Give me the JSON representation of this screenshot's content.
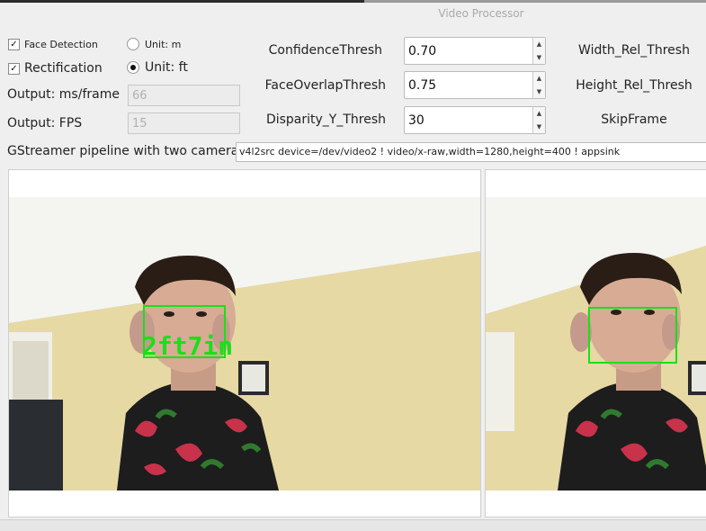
{
  "window": {
    "title": "Video Processor"
  },
  "options": {
    "face_detection": {
      "label": "Face Detection",
      "checked": true
    },
    "rectification": {
      "label": "Rectification",
      "checked": true
    },
    "unit_m": {
      "label": "Unit: m",
      "selected": false
    },
    "unit_ft": {
      "label": "Unit: ft",
      "selected": true
    }
  },
  "outputs": {
    "ms_frame": {
      "label": "Output: ms/frame",
      "value": "66"
    },
    "fps": {
      "label": "Output: FPS",
      "value": "15"
    }
  },
  "params": [
    {
      "label": "ConfidenceThresh",
      "value": "0.70"
    },
    {
      "label": "FaceOverlapThresh",
      "value": "0.75"
    },
    {
      "label": "Disparity_Y_Thresh",
      "value": "30"
    }
  ],
  "right_labels": [
    "Width_Rel_Thresh",
    "Height_Rel_Thresh",
    "SkipFrame"
  ],
  "pipeline": {
    "label": "GStreamer pipeline with two cameras:",
    "value": "v4l2src device=/dev/video2 ! video/x-raw,width=1280,height=400 ! appsink"
  },
  "left_view": {
    "distance_label": "2ft7in"
  },
  "colors": {
    "detection_box": "#19e019"
  }
}
